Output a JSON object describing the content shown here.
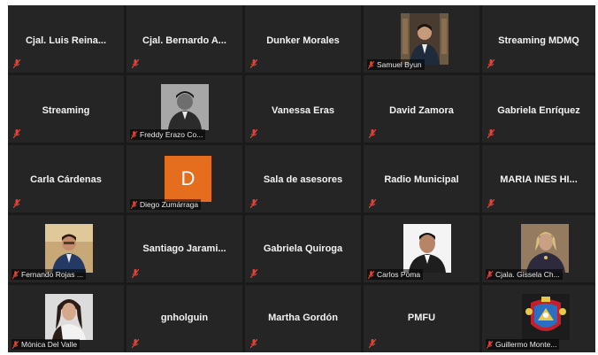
{
  "colors": {
    "tile_bg": "#252525",
    "grid_bg": "#1a1a1a",
    "muted_red": "#e0453a",
    "avatar_orange": "#e46d1e"
  },
  "participants": [
    {
      "name": "Cjal. Luis Reina...",
      "icon": "muted-mic-icon"
    },
    {
      "name": "Cjal. Bernardo A...",
      "icon": "muted-mic-icon"
    },
    {
      "name": "Dunker Morales",
      "icon": "muted-mic-icon"
    },
    {
      "name": "Samuel Byun",
      "icon": "muted-mic-icon"
    },
    {
      "name": "Streaming MDMQ",
      "icon": "muted-mic-icon"
    },
    {
      "name": "Streaming",
      "icon": "muted-mic-icon"
    },
    {
      "name": "Freddy Erazo Co...",
      "icon": "muted-mic-icon"
    },
    {
      "name": "Vanessa Eras",
      "icon": "muted-mic-icon"
    },
    {
      "name": "David Zamora",
      "icon": "muted-mic-icon"
    },
    {
      "name": "Gabriela Enríquez",
      "icon": "muted-mic-icon"
    },
    {
      "name": "Carla Cárdenas",
      "icon": "muted-mic-icon"
    },
    {
      "name": "Diego Zumárraga",
      "avatar_letter": "D",
      "icon": "muted-mic-icon"
    },
    {
      "name": "Sala de asesores",
      "icon": "muted-mic-icon"
    },
    {
      "name": "Radio Municipal",
      "icon": "muted-mic-icon"
    },
    {
      "name": "MARIA INES HI...",
      "icon": "muted-mic-icon"
    },
    {
      "name": "Fernando Rojas ...",
      "icon": "muted-mic-icon"
    },
    {
      "name": "Santiago Jarami...",
      "icon": "muted-mic-icon"
    },
    {
      "name": "Gabriela Quiroga",
      "icon": "muted-mic-icon"
    },
    {
      "name": "Carlos Poma",
      "icon": "muted-mic-icon"
    },
    {
      "name": "Cjala. Gissela Ch...",
      "icon": "muted-mic-icon"
    },
    {
      "name": "Mónica Del Valle",
      "icon": "muted-mic-icon"
    },
    {
      "name": "gnholguin",
      "icon": "muted-mic-icon"
    },
    {
      "name": "Martha Gordón",
      "icon": "muted-mic-icon"
    },
    {
      "name": "PMFU",
      "icon": "muted-mic-icon"
    },
    {
      "name": "Guillermo Monte...",
      "icon": "muted-mic-icon"
    }
  ]
}
